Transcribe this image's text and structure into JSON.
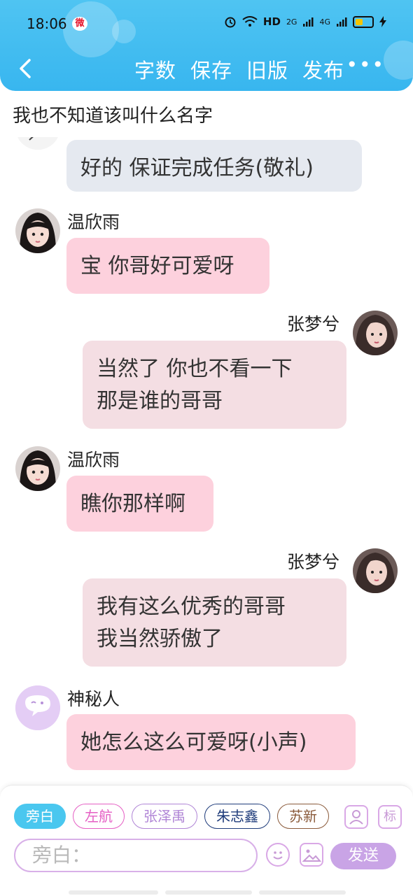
{
  "status_bar": {
    "time": "18:06",
    "network": "HD",
    "signal_a": "2G",
    "signal_b": "4G"
  },
  "nav": {
    "actions": [
      "字数",
      "保存",
      "旧版",
      "发布"
    ]
  },
  "chat_title": "我也不知道该叫什么名字",
  "messages": [
    {
      "side": "left",
      "text": "好的 保证完成任务(敬礼)"
    },
    {
      "side": "left",
      "name": "温欣雨",
      "text": "宝 你哥好可爱呀"
    },
    {
      "side": "right",
      "name": "张梦兮",
      "lines": [
        "当然了 你也不看一下",
        "那是谁的哥哥"
      ]
    },
    {
      "side": "left",
      "name": "温欣雨",
      "text": "瞧你那样啊"
    },
    {
      "side": "right",
      "name": "张梦兮",
      "lines": [
        "我有这么优秀的哥哥",
        "我当然骄傲了"
      ]
    },
    {
      "side": "left",
      "name": "神秘人",
      "text": "她怎么这么可爱呀(小声)"
    }
  ],
  "composer": {
    "chips": [
      "旁白",
      "左航",
      "张泽禹",
      "朱志鑫",
      "苏新"
    ],
    "mark_label": "标",
    "input_placeholder": "旁白：",
    "send_label": "发送"
  },
  "colors": {
    "header": "#38b6ef",
    "left_bubble": "#fdd1dd",
    "right_bubble": "#f4dee3",
    "narration_bubble": "#e5e9f0",
    "send": "#c9a4e6"
  }
}
